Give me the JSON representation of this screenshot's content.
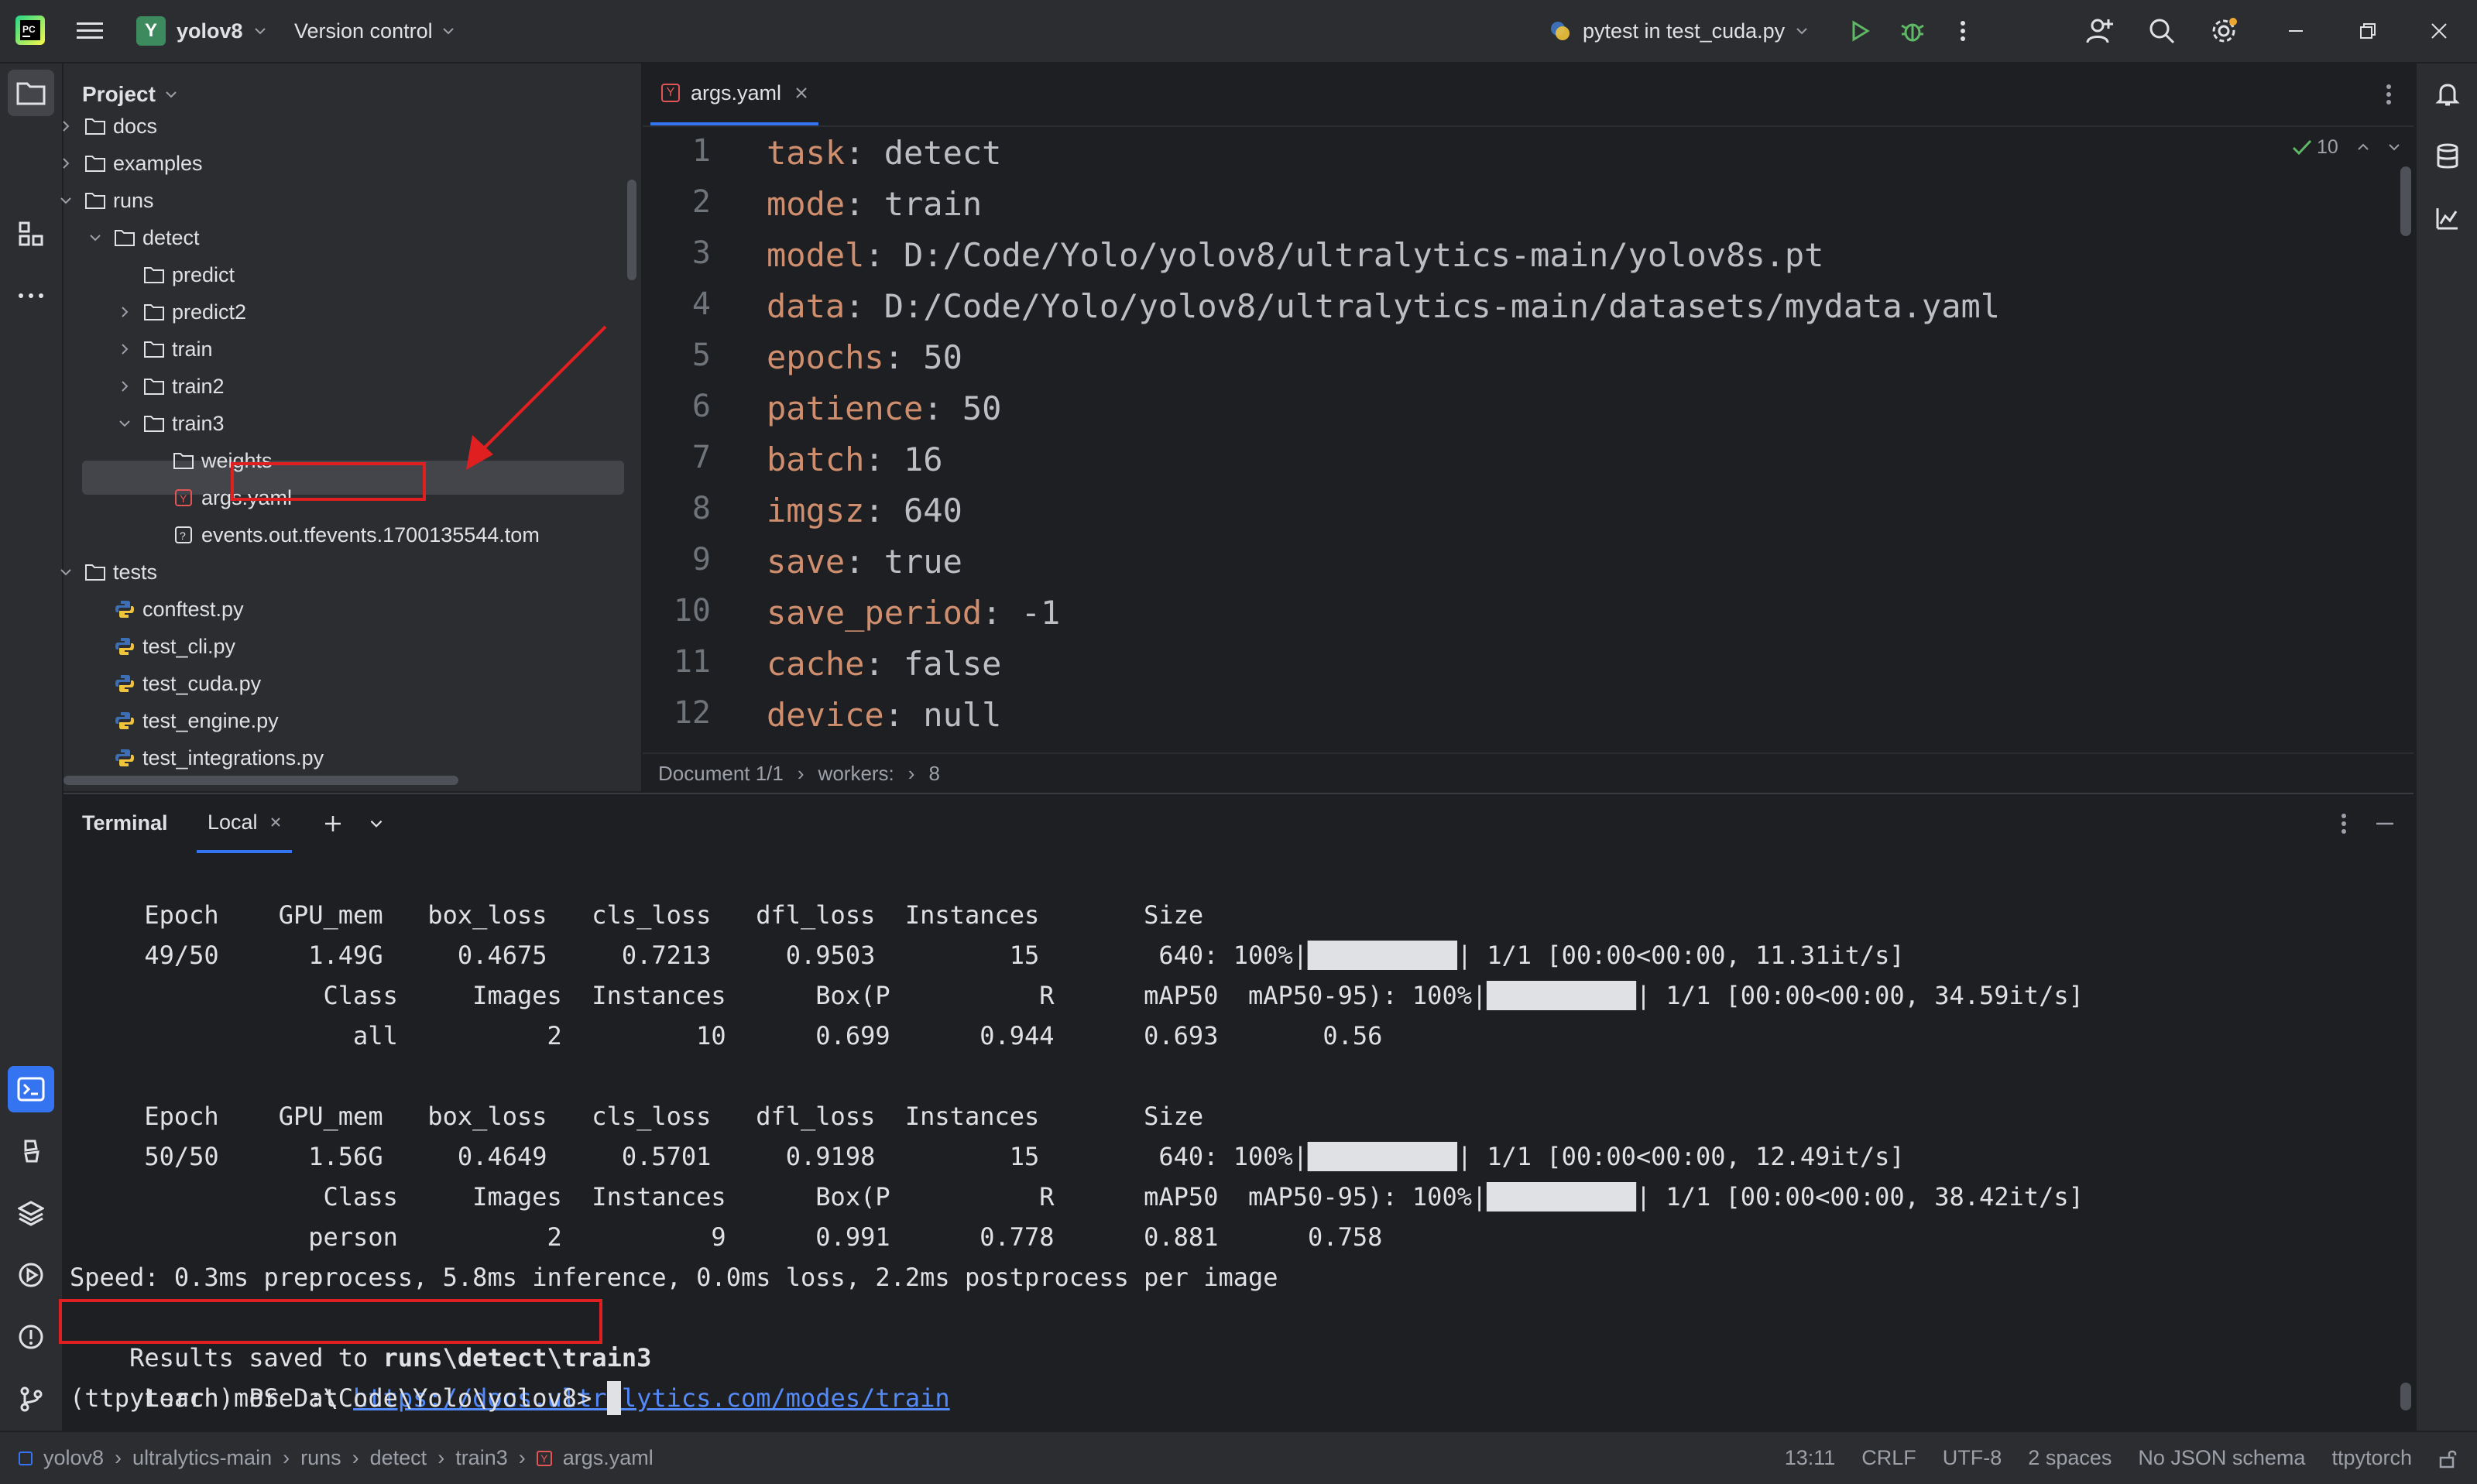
{
  "titlebar": {
    "project_badge": "Y",
    "project_name": "yolov8",
    "vcs": "Version control",
    "run_config": "pytest in test_cuda.py"
  },
  "project_panel": {
    "title": "Project",
    "tree": [
      {
        "label": "docs",
        "kind": "folder",
        "chevron": "right"
      },
      {
        "label": "examples",
        "kind": "folder",
        "chevron": "right"
      },
      {
        "label": "runs",
        "kind": "folder",
        "chevron": "down"
      },
      {
        "label": "detect",
        "kind": "folder",
        "chevron": "down"
      },
      {
        "label": "predict",
        "kind": "folder",
        "chevron": ""
      },
      {
        "label": "predict2",
        "kind": "folder",
        "chevron": "right"
      },
      {
        "label": "train",
        "kind": "folder",
        "chevron": "right"
      },
      {
        "label": "train2",
        "kind": "folder",
        "chevron": "right"
      },
      {
        "label": "train3",
        "kind": "folder",
        "chevron": "down"
      },
      {
        "label": "weights",
        "kind": "folder",
        "chevron": ""
      },
      {
        "label": "args.yaml",
        "kind": "yaml",
        "chevron": ""
      },
      {
        "label": "events.out.tfevents.1700135544.tom",
        "kind": "unknown",
        "chevron": ""
      },
      {
        "label": "tests",
        "kind": "folder",
        "chevron": "down"
      },
      {
        "label": "conftest.py",
        "kind": "python",
        "chevron": ""
      },
      {
        "label": "test_cli.py",
        "kind": "python",
        "chevron": ""
      },
      {
        "label": "test_cuda.py",
        "kind": "python",
        "chevron": ""
      },
      {
        "label": "test_engine.py",
        "kind": "python",
        "chevron": ""
      },
      {
        "label": "test_integrations.py",
        "kind": "python",
        "chevron": ""
      }
    ]
  },
  "editor": {
    "tab_label": "args.yaml",
    "inspection_count": "10",
    "lines": [
      {
        "n": "1",
        "key": "task",
        "value": " detect"
      },
      {
        "n": "2",
        "key": "mode",
        "value": " train"
      },
      {
        "n": "3",
        "key": "model",
        "value": " D:/Code/Yolo/yolov8/ultralytics-main/yolov8s.pt"
      },
      {
        "n": "4",
        "key": "data",
        "value": " D:/Code/Yolo/yolov8/ultralytics-main/datasets/mydata.yaml"
      },
      {
        "n": "5",
        "key": "epochs",
        "value": " 50"
      },
      {
        "n": "6",
        "key": "patience",
        "value": " 50"
      },
      {
        "n": "7",
        "key": "batch",
        "value": " 16"
      },
      {
        "n": "8",
        "key": "imgsz",
        "value": " 640"
      },
      {
        "n": "9",
        "key": "save",
        "value": " true"
      },
      {
        "n": "10",
        "key": "save_period",
        "value": " -1"
      },
      {
        "n": "11",
        "key": "cache",
        "value": " false"
      },
      {
        "n": "12",
        "key": "device",
        "value": " null"
      }
    ],
    "breadcrumb": [
      "Document 1/1",
      "workers:",
      "8"
    ]
  },
  "terminal": {
    "title": "Terminal",
    "tab": "Local",
    "lines": [
      "     Epoch    GPU_mem   box_loss   cls_loss   dfl_loss  Instances       Size",
      "     49/50      1.49G     0.4675     0.7213     0.9503         15        640: 100%|██████████| 1/1 [00:00<00:00, 11.31it/s]",
      "                 Class     Images  Instances      Box(P          R      mAP50  mAP50-95): 100%|██████████| 1/1 [00:00<00:00, 34.59it/s]",
      "                   all          2         10      0.699      0.944      0.693       0.56",
      "",
      "     Epoch    GPU_mem   box_loss   cls_loss   dfl_loss  Instances       Size",
      "     50/50      1.56G     0.4649     0.5701     0.9198         15        640: 100%|██████████| 1/1 [00:00<00:00, 12.49it/s]",
      "                 Class     Images  Instances      Box(P          R      mAP50  mAP50-95): 100%|██████████| 1/1 [00:00<00:00, 38.42it/s]",
      "                person          2          9      0.991      0.778      0.881      0.758",
      "Speed: 0.3ms preprocess, 5.8ms inference, 0.0ms loss, 2.2ms postprocess per image"
    ],
    "results_prefix": "Results saved to ",
    "results_path": "runs\\detect\\train3",
    "learn_prefix": " Learn more at ",
    "learn_link": "https://docs.ultralytics.com/modes/train",
    "prompt": "(ttpytorch) PS D:\\Code\\Yolo\\yolov8> "
  },
  "statusbar": {
    "crumbs": [
      "yolov8",
      "ultralytics-main",
      "runs",
      "detect",
      "train3",
      "args.yaml"
    ],
    "position": "13:11",
    "line_sep": "CRLF",
    "encoding": "UTF-8",
    "indent": "2 spaces",
    "schema": "No JSON schema",
    "interpreter": "ttpytorch"
  },
  "colors": {
    "accent": "#3574f0",
    "highlight_box": "#e02020",
    "yaml_key": "#cf8e6d",
    "link": "#548af7"
  }
}
